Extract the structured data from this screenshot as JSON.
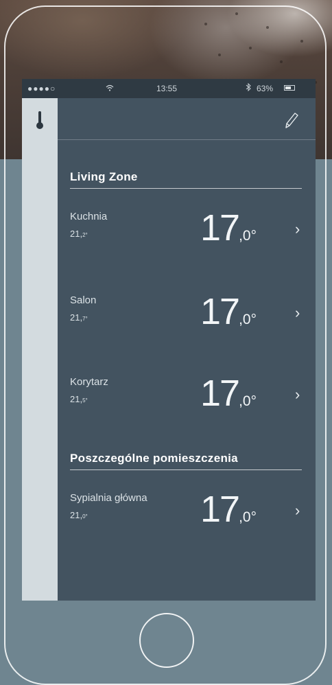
{
  "status_bar": {
    "carrier": "●●●●○",
    "time": "13:55",
    "battery_text": "63%",
    "battery_level": 0.63
  },
  "header": {
    "left_icon": "thermometer-icon",
    "right_icon": "pencil-icon"
  },
  "sections": [
    {
      "title": "Living Zone",
      "rooms": [
        {
          "name": "Kuchnia",
          "current_int": "21,",
          "current_dec": "2°",
          "set_int": "17",
          "set_dec": ",0°"
        },
        {
          "name": "Salon",
          "current_int": "21,",
          "current_dec": "7°",
          "set_int": "17",
          "set_dec": ",0°"
        },
        {
          "name": "Korytarz",
          "current_int": "21,",
          "current_dec": "5°",
          "set_int": "17",
          "set_dec": ",0°"
        }
      ]
    },
    {
      "title": "Poszczególne pomieszczenia",
      "rooms": [
        {
          "name": "Sypialnia główna",
          "current_int": "21,",
          "current_dec": "0°",
          "set_int": "17",
          "set_dec": ",0°"
        }
      ]
    }
  ],
  "chevron": "›",
  "colors": {
    "background": "#6f8590",
    "screen": "#435360",
    "sidebar": "#d3dbdf",
    "status_bar": "#2f3a43"
  }
}
